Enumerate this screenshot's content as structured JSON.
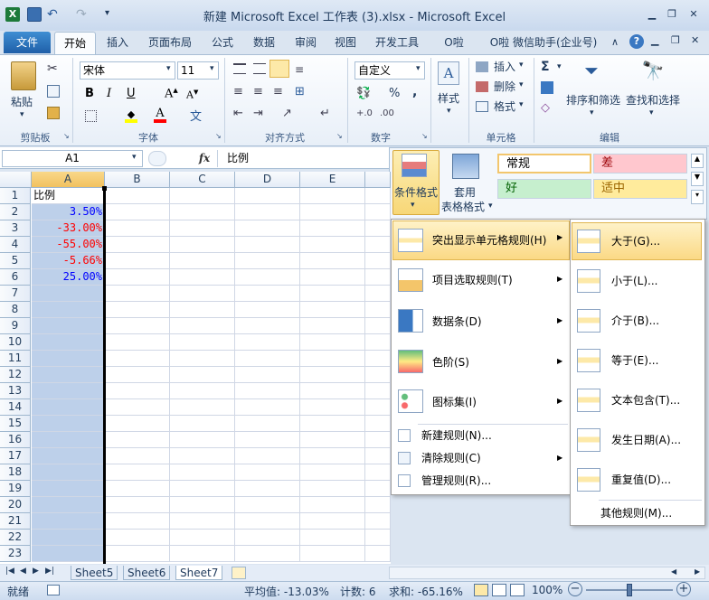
{
  "window": {
    "title": "新建 Microsoft Excel 工作表 (3).xlsx - Microsoft Excel"
  },
  "tabs": [
    "文件",
    "开始",
    "插入",
    "页面布局",
    "公式",
    "数据",
    "审阅",
    "视图",
    "开发工具",
    "O啦",
    "O啦 微信助手(企业号)"
  ],
  "ribbon": {
    "clipboard": {
      "paste": "粘贴",
      "group": "剪贴板"
    },
    "font": {
      "name": "宋体",
      "size": "11",
      "group": "字体"
    },
    "alignment": {
      "group": "对齐方式"
    },
    "number": {
      "format": "自定义",
      "percent": "%",
      "comma": ",",
      "group": "数字"
    },
    "styles": {
      "style_label": "样式",
      "cond_format": "条件格式",
      "table_format_1": "套用",
      "table_format_2": "表格格式",
      "normal": "常规",
      "bad": "差",
      "good": "好",
      "neutral": "适中"
    },
    "cells": {
      "insert": "插入",
      "delete": "删除",
      "format": "格式",
      "group": "单元格"
    },
    "editing": {
      "sort": "排序和筛选",
      "find": "查找和选择",
      "sum": "Σ",
      "group": "编辑"
    }
  },
  "formula": {
    "namebox": "A1",
    "fx": "fx",
    "content": "比例"
  },
  "columns": [
    "A",
    "B",
    "C",
    "D",
    "E"
  ],
  "rows": [
    "1",
    "2",
    "3",
    "4",
    "5",
    "6",
    "7",
    "8",
    "9",
    "10",
    "11",
    "12",
    "13",
    "14",
    "15",
    "16",
    "17",
    "18",
    "19",
    "20",
    "21",
    "22",
    "23"
  ],
  "cells": [
    {
      "row": 0,
      "text": "比例",
      "color": "#000000",
      "align": "left"
    },
    {
      "row": 1,
      "text": "3.50%",
      "color": "#0000ff",
      "align": "right"
    },
    {
      "row": 2,
      "text": "-33.00%",
      "color": "#ff0000",
      "align": "right"
    },
    {
      "row": 3,
      "text": "-55.00%",
      "color": "#ff0000",
      "align": "right"
    },
    {
      "row": 4,
      "text": "-5.66%",
      "color": "#ff0000",
      "align": "right"
    },
    {
      "row": 5,
      "text": "25.00%",
      "color": "#0000ff",
      "align": "right"
    }
  ],
  "menu": {
    "items": [
      {
        "label": "突出显示单元格规则(H)"
      },
      {
        "label": "项目选取规则(T)"
      },
      {
        "label": "数据条(D)"
      },
      {
        "label": "色阶(S)"
      },
      {
        "label": "图标集(I)"
      }
    ],
    "small_items": [
      {
        "label": "新建规则(N)..."
      },
      {
        "label": "清除规则(C)"
      },
      {
        "label": "管理规则(R)..."
      }
    ]
  },
  "submenu": {
    "items": [
      {
        "label": "大于(G)..."
      },
      {
        "label": "小于(L)..."
      },
      {
        "label": "介于(B)..."
      },
      {
        "label": "等于(E)..."
      },
      {
        "label": "文本包含(T)..."
      },
      {
        "label": "发生日期(A)..."
      },
      {
        "label": "重复值(D)..."
      }
    ],
    "other": "其他规则(M)..."
  },
  "sheets": [
    "Sheet5",
    "Sheet6",
    "Sheet7"
  ],
  "status": {
    "ready": "就绪",
    "average": "平均值: -13.03%",
    "count": "计数: 6",
    "sum": "求和: -65.16%",
    "zoom": "100%"
  },
  "colors": {
    "accent": "#1f5fa8",
    "menu_highlight": "#fde9a8",
    "selected_column": "#bdd0ea"
  }
}
